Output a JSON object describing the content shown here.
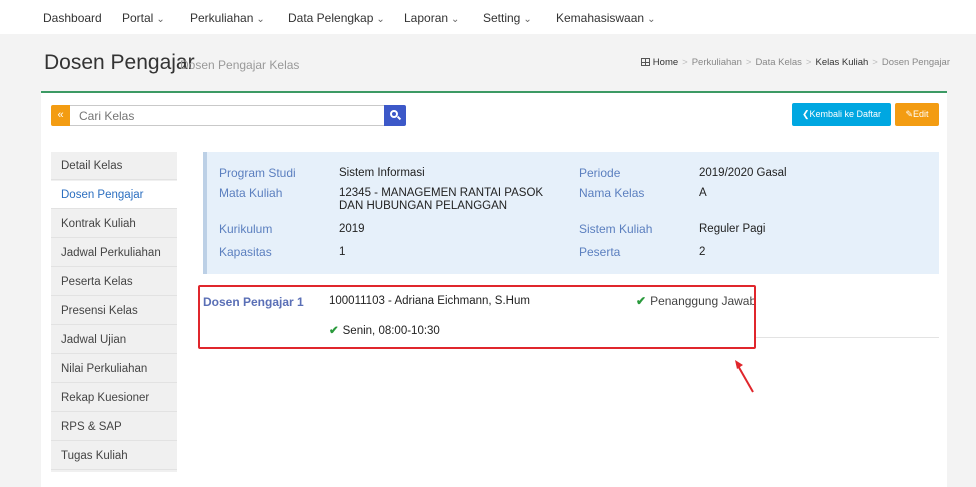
{
  "topnav": {
    "items": [
      {
        "label": "Dashboard",
        "caret": ""
      },
      {
        "label": "Portal",
        "caret": "⌄"
      },
      {
        "label": "Perkuliahan",
        "caret": "⌄"
      },
      {
        "label": "Data Pelengkap",
        "caret": "⌄"
      },
      {
        "label": "Laporan",
        "caret": "⌄"
      },
      {
        "label": "Setting",
        "caret": "⌄"
      },
      {
        "label": "Kemahasiswaan",
        "caret": "⌄"
      }
    ]
  },
  "header": {
    "title": "Dosen Pengajar",
    "subtitle": "Dosen Pengajar Kelas",
    "breadcrumb": [
      "Home",
      "Perkuliahan",
      "Data Kelas",
      "Kelas Kuliah",
      "Dosen Pengajar"
    ]
  },
  "search": {
    "placeholder": "Cari Kelas",
    "toggle_label": "«"
  },
  "buttons": {
    "back": "❮Kembali ke Daftar",
    "edit": "✎Edit"
  },
  "sidebar": {
    "items": [
      {
        "label": "Detail Kelas"
      },
      {
        "label": "Dosen Pengajar"
      },
      {
        "label": "Kontrak Kuliah"
      },
      {
        "label": "Jadwal Perkuliahan"
      },
      {
        "label": "Peserta Kelas"
      },
      {
        "label": "Presensi Kelas"
      },
      {
        "label": "Jadwal Ujian"
      },
      {
        "label": "Nilai Perkuliahan"
      },
      {
        "label": "Rekap Kuesioner"
      },
      {
        "label": "RPS & SAP"
      },
      {
        "label": "Tugas Kuliah"
      }
    ],
    "active_index": 1
  },
  "class_info": {
    "program_studi_label": "Program Studi",
    "program_studi": "Sistem Informasi",
    "mata_kuliah_label": "Mata Kuliah",
    "mata_kuliah": "12345 - MANAGEMEN RANTAI PASOK DAN HUBUNGAN PELANGGAN",
    "kurikulum_label": "Kurikulum",
    "kurikulum": "2019",
    "kapasitas_label": "Kapasitas",
    "kapasitas": "1",
    "periode_label": "Periode",
    "periode": "2019/2020 Gasal",
    "nama_kelas_label": "Nama Kelas",
    "nama_kelas": "A",
    "sistem_kuliah_label": "Sistem Kuliah",
    "sistem_kuliah": "Reguler Pagi",
    "peserta_label": "Peserta",
    "peserta": "2"
  },
  "lecturer": {
    "label": "Dosen Pengajar 1",
    "id_name": "100011103 - Adriana Eichmann, S.Hum",
    "role": "Penanggung Jawab",
    "schedule": "Senin, 08:00-10:30",
    "check_icon": "✔"
  },
  "colors": {
    "accent_green": "#3c9a64",
    "orange": "#f39c12",
    "blue_search": "#3c58c8",
    "cyan_button": "#00a7e1",
    "highlight_red": "#e0262c"
  }
}
